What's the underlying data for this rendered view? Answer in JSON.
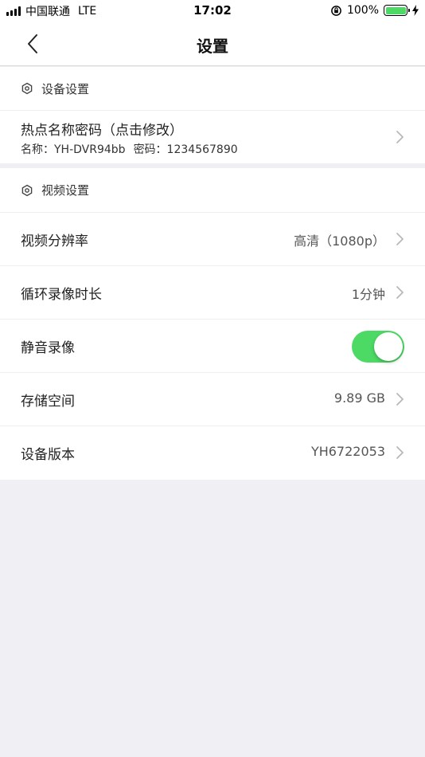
{
  "status_bar": {
    "carrier": "中国联通",
    "network": "LTE",
    "time": "17:02",
    "battery_percent": "100%",
    "battery_level": 1.0
  },
  "nav": {
    "title": "设置",
    "back_icon": "chevron-left-icon"
  },
  "device_section": {
    "header": "设备设置",
    "hotspot": {
      "title": "热点名称密码（点击修改）",
      "name_text": "名称：YH-DVR94bb",
      "password_text": "密码：1234567890"
    }
  },
  "video_section": {
    "header": "视频设置",
    "rows": [
      {
        "label": "视频分辨率",
        "value": "高清（1080p）"
      },
      {
        "label": "循环录像时长",
        "value": "1分钟"
      },
      {
        "label": "静音录像",
        "toggle_on": true
      },
      {
        "label": "存储空间",
        "value": "9.89 GB"
      },
      {
        "label": "设备版本",
        "value": "YH6722053"
      }
    ]
  },
  "colors": {
    "accent_green": "#4cd964",
    "background": "#efeff4"
  }
}
